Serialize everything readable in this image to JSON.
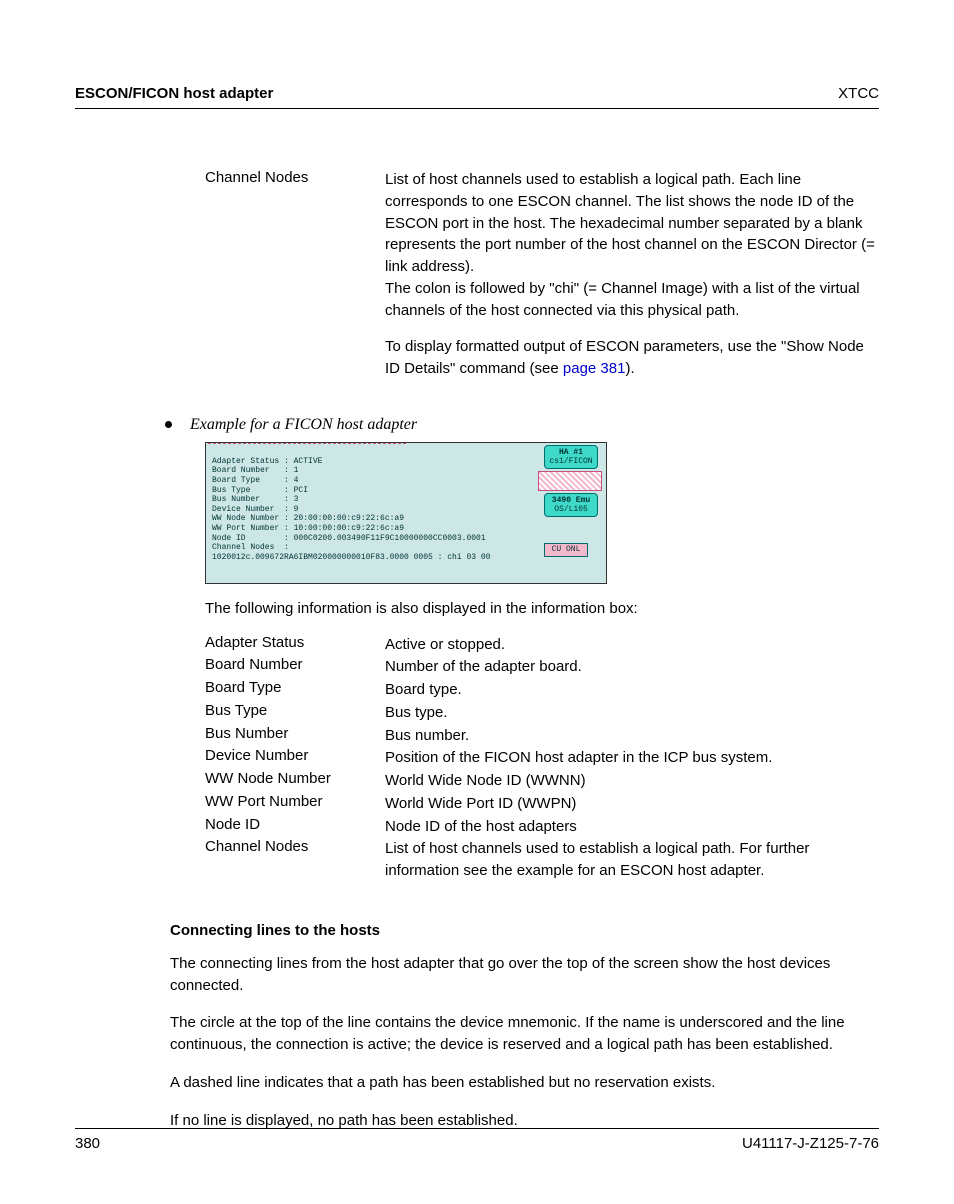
{
  "header": {
    "left": "ESCON/FICON host adapter",
    "right": "XTCC"
  },
  "top_def": {
    "term": "Channel Nodes",
    "desc1": "List of host channels used to establish a logical path. Each line corresponds to one ESCON channel. The list shows the node ID of the ESCON port in the host. The hexadecimal number separated by a blank represents the port number of the host channel on the ESCON Director (= link address).",
    "desc2": "The colon is followed by \"chi\" (= Channel Image) with a list of the virtual channels of the host connected via this physical path.",
    "desc3_pre": "To display formatted output of ESCON parameters, use the \"Show Node ID Details\" command (see ",
    "desc3_link": "page 381",
    "desc3_post": ")."
  },
  "example_caption": "Example for a FICON host adapter",
  "shot": {
    "lines": "Adapter Status : ACTIVE\nBoard Number   : 1\nBoard Type     : 4\nBus Type       : PCI\nBus Number     : 3\nDevice Number  : 9\nWW Node Number : 20:00:00:00:c9:22:6c:a9\nWW Port Number : 10:00:00:00:c9:22:6c:a9\nNode ID        : 000C0200.003490F11F9C10000000CC0003.0001\nChannel Nodes  :\n1020012c.009672RA6IBM020000000010F83.0000 0005 : chi 03 00",
    "ha": "HA #1",
    "ha2": "cs1/FICON",
    "emu": "3490 Emu",
    "emu2": "OS/L105",
    "cu": "CU ONL"
  },
  "following": "The following information is also displayed in the information box:",
  "defs": [
    {
      "term": "Adapter Status",
      "desc": "Active or stopped."
    },
    {
      "term": "Board Number",
      "desc": "Number of the adapter board."
    },
    {
      "term": "Board Type",
      "desc": "Board type."
    },
    {
      "term": "Bus Type",
      "desc": "Bus type."
    },
    {
      "term": "Bus Number",
      "desc": "Bus number."
    },
    {
      "term": "Device Number",
      "desc": "Position of the FICON host adapter in the ICP bus system."
    },
    {
      "term": "WW Node Number",
      "desc": "World Wide Node ID (WWNN)"
    },
    {
      "term": "WW Port Number",
      "desc": "World Wide Port ID (WWPN)"
    },
    {
      "term": "Node ID",
      "desc": "Node ID of the host adapters"
    },
    {
      "term": "Channel Nodes",
      "desc": "List of host channels used to establish a logical path. For further information see the example for an ESCON host adapter."
    }
  ],
  "connecting": {
    "heading": "Connecting lines to the hosts",
    "p1": "The connecting lines from the host adapter that go over the top of the screen show the host devices connected.",
    "p2": "The circle at the top of the line contains the device mnemonic. If the name is underscored and the line continuous, the connection is active; the device is reserved and a logical path has been established.",
    "p3": "A dashed line indicates that a path has been established but no reservation exists.",
    "p4": "If no line is displayed, no path has been established."
  },
  "footer": {
    "page": "380",
    "docid": "U41117-J-Z125-7-76"
  }
}
